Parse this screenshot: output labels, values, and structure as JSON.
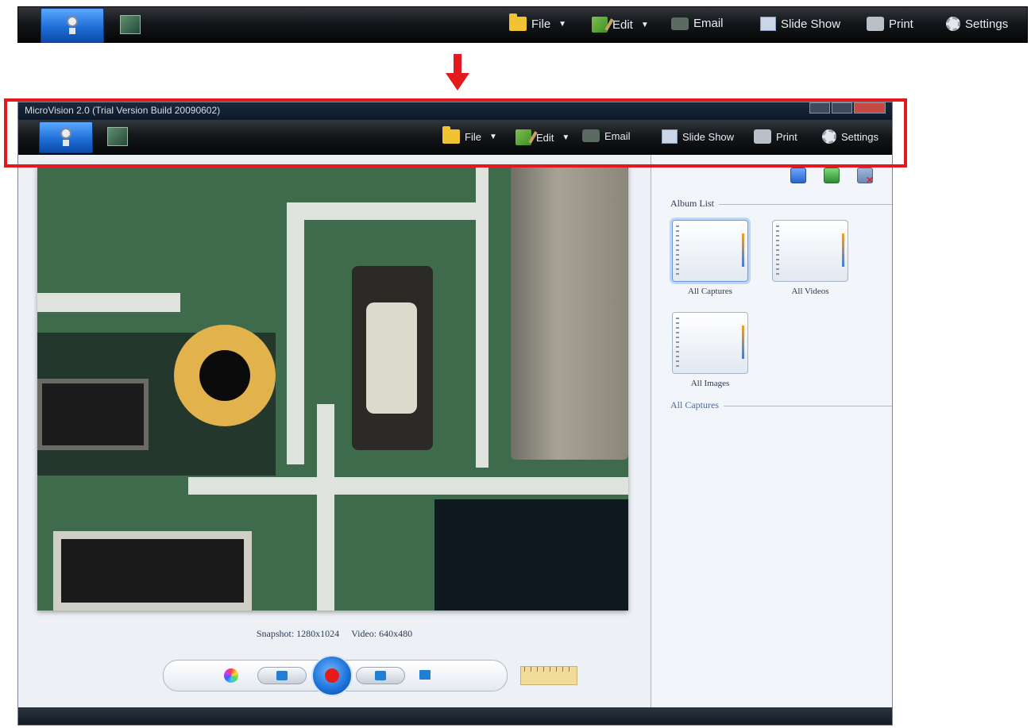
{
  "toolbar": {
    "file_label": "File",
    "edit_label": "Edit",
    "email_label": "Email",
    "slideshow_label": "Slide Show",
    "print_label": "Print",
    "settings_label": "Settings",
    "dropdown_caret": "▼"
  },
  "window": {
    "title": "MicroVision 2.0 (Trial Version Build 20090602)"
  },
  "viewer": {
    "snapshot_resolution": "Snapshot: 1280x1024",
    "video_resolution": "Video: 640x480"
  },
  "panel": {
    "album_list_heading": "Album List",
    "albums": [
      {
        "label": "All Captures"
      },
      {
        "label": "All Videos"
      },
      {
        "label": "All Images"
      }
    ],
    "current_album_heading": "All Captures"
  },
  "colors": {
    "highlight_red": "#e3191d",
    "toolbar_dark": "#14171a",
    "accent_blue": "#1f6fd8"
  },
  "icons": [
    "webcam-icon",
    "gallery-icon",
    "folder-icon",
    "edit-icon",
    "email-icon",
    "slideshow-icon",
    "print-icon",
    "gear-icon",
    "color-wheel-icon",
    "camera-icon",
    "record-icon",
    "monitor-icon",
    "ruler-icon"
  ]
}
